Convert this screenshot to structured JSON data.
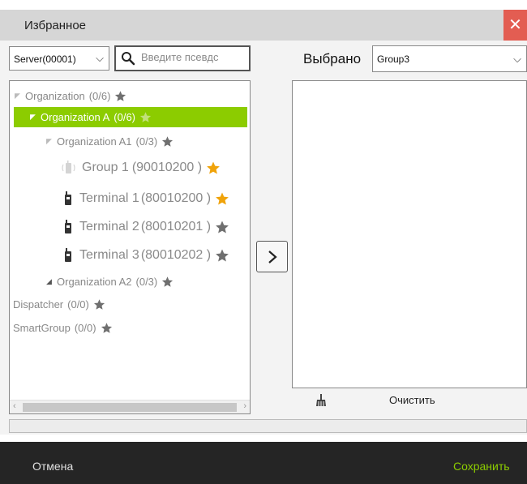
{
  "window": {
    "title": "Избранное",
    "close_glyph": "✕"
  },
  "left": {
    "server_select": "Server(00001)",
    "search_placeholder": "Введите псевдс"
  },
  "right": {
    "selected_label": "Выбрано",
    "group_select": "Group3",
    "clear_label": "Очистить"
  },
  "tree": {
    "organization": {
      "label": "Organization",
      "count": "(0/6)",
      "starred": false
    },
    "org_a": {
      "label": "Organization A",
      "count": "(0/6)",
      "starred": false,
      "selected": true
    },
    "org_a1": {
      "label": "Organization A1",
      "count": "(0/3)",
      "starred": false
    },
    "group1": {
      "label": "Group 1",
      "id": "(90010200 )",
      "starred": true
    },
    "terminal1": {
      "label": "Terminal 1",
      "id": "(80010200 )",
      "starred": true
    },
    "terminal2": {
      "label": "Terminal 2",
      "id": "(80010201 )",
      "starred": false
    },
    "terminal3": {
      "label": "Terminal 3",
      "id": "(80010202 )",
      "starred": false
    },
    "org_a2": {
      "label": "Organization A2",
      "count": "(0/3)",
      "starred": false
    },
    "dispatcher": {
      "label": "Dispatcher",
      "count": "(0/0)",
      "starred": false
    },
    "smartgroup": {
      "label": "SmartGroup",
      "count": "(0/0)",
      "starred": false
    }
  },
  "footer": {
    "cancel": "Отмена",
    "save": "Сохранить"
  },
  "colors": {
    "accent_green": "#8ccc00",
    "star_gold": "#f0a30a",
    "star_gray": "#6f6f6f",
    "close_red": "#e35d52",
    "footer_bg": "#252525"
  },
  "icons": {
    "search": "search-icon",
    "arrow_right": "chevron-right-icon",
    "clear": "broom-icon",
    "device": "radio-device-icon",
    "group": "group-icon",
    "star": "star-icon"
  }
}
